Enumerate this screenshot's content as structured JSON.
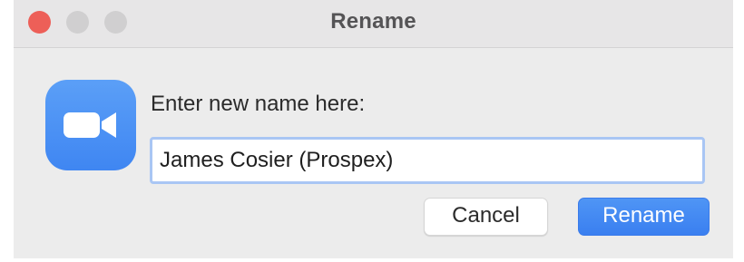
{
  "window": {
    "title": "Rename"
  },
  "dialog": {
    "prompt": "Enter new name here:",
    "input_value": "James Cosier (Prospex)"
  },
  "buttons": {
    "cancel_label": "Cancel",
    "rename_label": "Rename"
  },
  "icons": {
    "app": "zoom-video-camera-icon"
  },
  "colors": {
    "close": "#ed5f58",
    "accent": "#3f86f2",
    "input_focus": "#a9c6f4"
  }
}
